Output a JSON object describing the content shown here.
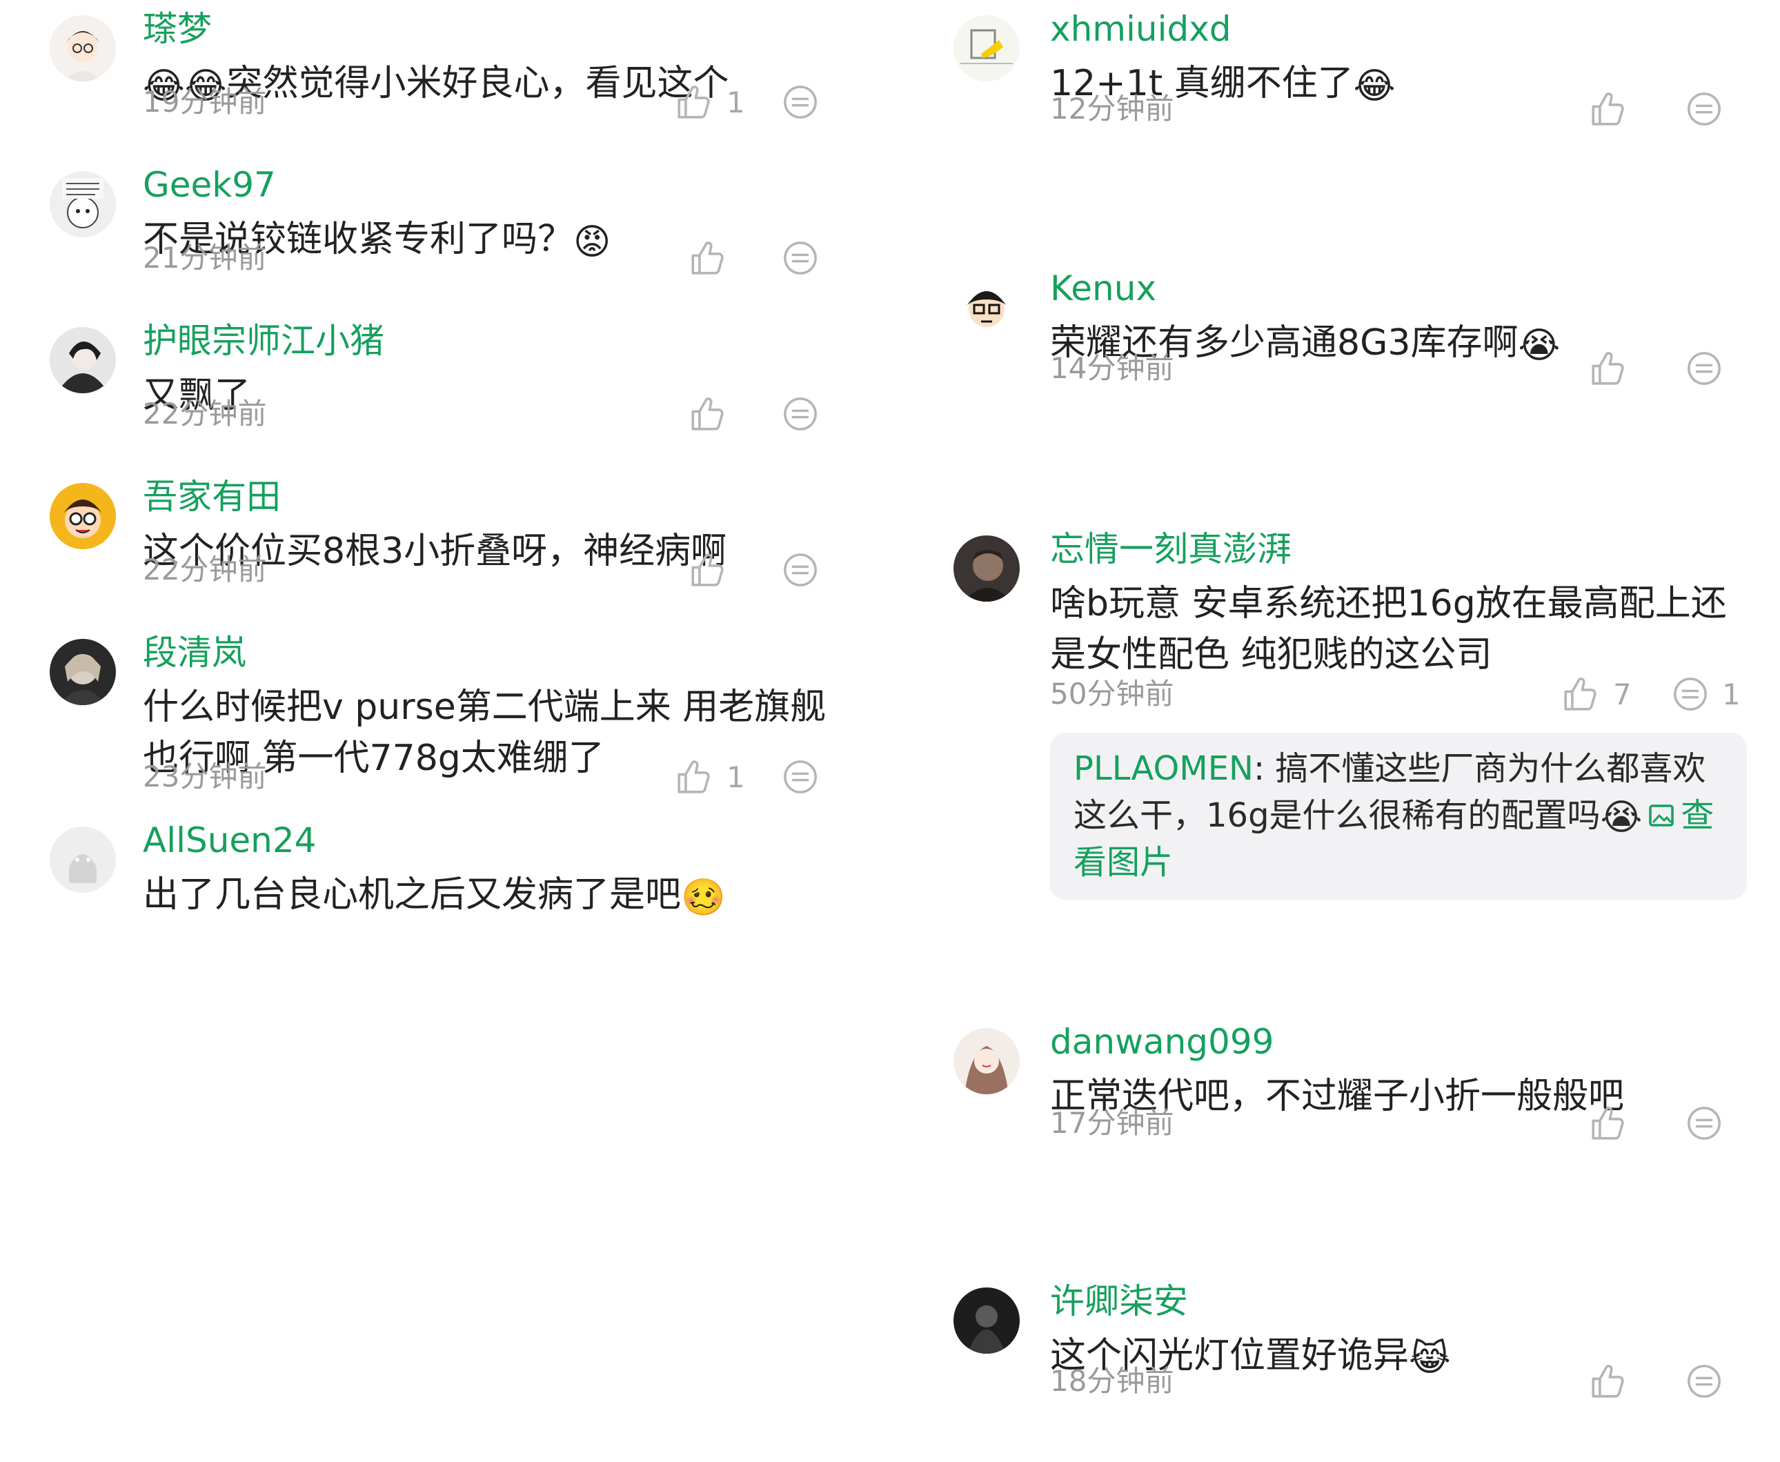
{
  "colors": {
    "accent_green": "#16a05d",
    "text": "#222222",
    "meta_gray": "#9a9a9a",
    "icon_gray": "#b5b5b5",
    "reply_bg": "#f2f2f4"
  },
  "left_column": {
    "comments": [
      {
        "username": "瑹梦",
        "emoji_prefix": "😂😂",
        "text": "突然觉得小米好良心，看见这个",
        "emoji_suffix": "",
        "time": "19分钟前",
        "likes": "1",
        "replies": ""
      },
      {
        "username": "Geek97",
        "emoji_prefix": "",
        "text": "不是说铰链收紧专利了吗？",
        "emoji_suffix": "😡",
        "time": "21分钟前",
        "likes": "",
        "replies": ""
      },
      {
        "username": "护眼宗师江小猪",
        "emoji_prefix": "",
        "text": "又飘了",
        "emoji_suffix": "",
        "time": "22分钟前",
        "likes": "",
        "replies": ""
      },
      {
        "username": "吾家有田",
        "emoji_prefix": "",
        "text": "这个价位买8根3小折叠呀，神经病啊",
        "emoji_suffix": "",
        "time": "22分钟前",
        "likes": "",
        "replies": ""
      },
      {
        "username": "段清岚",
        "emoji_prefix": "",
        "text_line1": "什么时候把v purse第二代端上来 用老旗舰",
        "text_line2": "也行啊 第一代778g太难绷了",
        "emoji_suffix": "",
        "time": "23分钟前",
        "likes": "1",
        "replies": ""
      },
      {
        "username": "AllSuen24",
        "emoji_prefix": "",
        "text": "出了几台良心机之后又发病了是吧",
        "emoji_suffix": "🥴",
        "time": "",
        "likes": "",
        "replies": ""
      }
    ]
  },
  "right_column": {
    "comments": [
      {
        "username": "xhmiuidxd",
        "text": "12+1t 真绷不住了",
        "emoji_suffix": "😂",
        "time": "12分钟前",
        "likes": "",
        "replies": ""
      },
      {
        "username": "Kenux",
        "text": "荣耀还有多少高通8G3库存啊",
        "emoji_suffix": "😭",
        "time": "14分钟前",
        "likes": "",
        "replies": ""
      },
      {
        "username": "忘情一刻真澎湃",
        "text_line1": "啥b玩意 安卓系统还把16g放在最高配上还",
        "text_line2": "是女性配色 纯犯贱的这公司",
        "time": "50分钟前",
        "likes": "7",
        "replies": "1",
        "reply": {
          "user": "PLLAOMEN",
          "text_line1": "搞不懂这些厂商为什么都喜欢",
          "text_line2": "这么干，16g是什么很稀有的配置吗",
          "emoji": "😭",
          "link_line2": "查",
          "link_line3": "看图片"
        }
      },
      {
        "username": "danwang099",
        "text": "正常迭代吧，不过耀子小折一般般吧",
        "emoji_suffix": "",
        "time": "17分钟前",
        "likes": "",
        "replies": ""
      },
      {
        "username": "许卿柒安",
        "text": "这个闪光灯位置好诡异",
        "emoji_suffix": "😹",
        "time": "18分钟前",
        "likes": "",
        "replies": ""
      }
    ]
  },
  "icons": {
    "like": "thumbs-up-icon",
    "reply": "comment-bubble-icon",
    "image": "image-icon"
  }
}
